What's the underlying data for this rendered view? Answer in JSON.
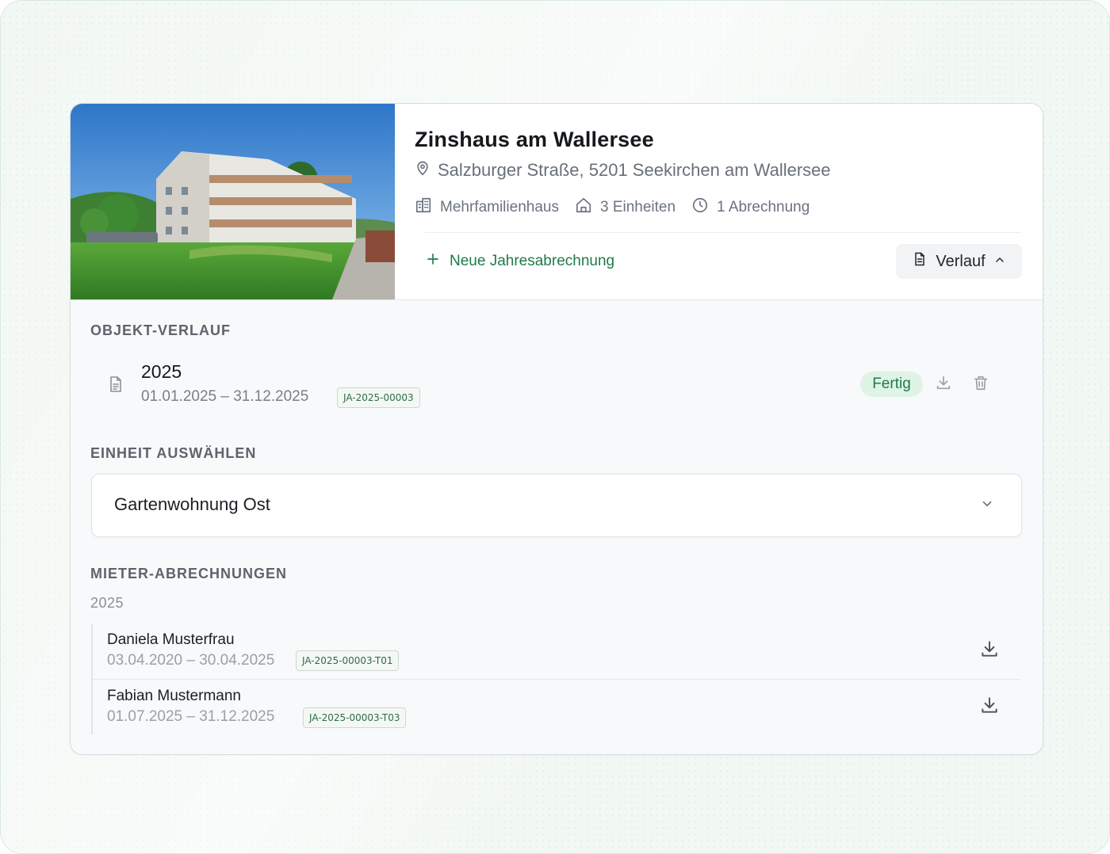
{
  "property": {
    "title": "Zinshaus am Wallersee",
    "address": "Salzburger Straße, 5201 Seekirchen am Wallersee",
    "meta": {
      "type": "Mehrfamilienhaus",
      "units": "3 Einheiten",
      "statements": "1 Abrechnung"
    }
  },
  "actions": {
    "new_statement": "Neue Jahresabrechnung",
    "history": "Verlauf"
  },
  "history": {
    "section_label": "OBJEKT-VERLAUF",
    "entries": [
      {
        "year": "2025",
        "period": "01.01.2025 – 31.12.2025",
        "ref": "JA-2025-00003",
        "status": "Fertig"
      }
    ]
  },
  "unit_select": {
    "section_label": "EINHEIT AUSWÄHLEN",
    "selected": "Gartenwohnung Ost"
  },
  "tenant_statements": {
    "section_label": "MIETER-ABRECHNUNGEN",
    "year": "2025",
    "items": [
      {
        "name": "Daniela Musterfrau",
        "period": "03.04.2020 – 30.04.2025",
        "ref": "JA-2025-00003-T01"
      },
      {
        "name": "Fabian Mustermann",
        "period": "01.07.2025 – 31.12.2025",
        "ref": "JA-2025-00003-T03"
      }
    ]
  },
  "icons": {
    "address": "map-pin-icon",
    "type": "building-icon",
    "units": "home-icon",
    "statements": "clock-icon",
    "new_statement": "plus-icon",
    "history": "document-icon",
    "history_toggle": "chevron-up-icon",
    "entry": "document-icon",
    "download": "download-icon",
    "delete": "trash-icon",
    "select": "chevron-down-icon"
  },
  "colors": {
    "accent": "#1f7a4a",
    "badge_bg": "#dff3e6"
  }
}
